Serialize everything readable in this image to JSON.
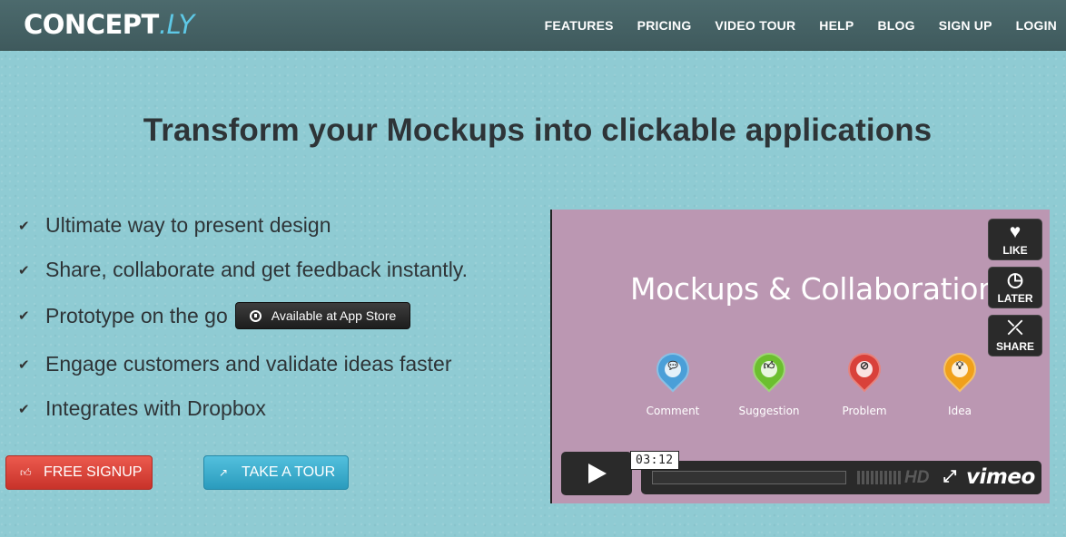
{
  "header": {
    "logo_main": "CONCEPT",
    "logo_accent": ".LY",
    "nav": [
      "FEATURES",
      "PRICING",
      "VIDEO TOUR",
      "HELP",
      "BLOG",
      "SIGN UP",
      "LOGIN"
    ]
  },
  "headline": "Transform your Mockups into clickable applications",
  "features": [
    "Ultimate way to present design",
    "Share, collaborate and get feedback instantly.",
    "Prototype on the go",
    "Engage customers and validate ideas faster",
    "Integrates with Dropbox"
  ],
  "appstore_label": "Available at App Store",
  "buttons": {
    "signup": "FREE SIGNUP",
    "tour": "TAKE A TOUR"
  },
  "video": {
    "title": "Mockups & Collaboration",
    "pins": [
      {
        "label": "Comment",
        "color": "#4a9fd8",
        "icon": "speech-bubble-icon"
      },
      {
        "label": "Suggestion",
        "color": "#6cbf2f",
        "icon": "thumbs-up-icon"
      },
      {
        "label": "Problem",
        "color": "#d9413a",
        "icon": "no-entry-icon"
      },
      {
        "label": "Idea",
        "color": "#f0a01a",
        "icon": "lightbulb-icon"
      }
    ],
    "side": {
      "like": "LIKE",
      "later": "LATER",
      "share": "SHARE"
    },
    "timecode": "03:12",
    "hd": "HD",
    "brand": "vimeo",
    "progress": 0
  },
  "colors": {
    "background": "#8fcbd3",
    "header": "#45625f",
    "signup": "#d9413a",
    "tour": "#3fb1d3",
    "video_bg": "#bb97b2"
  }
}
